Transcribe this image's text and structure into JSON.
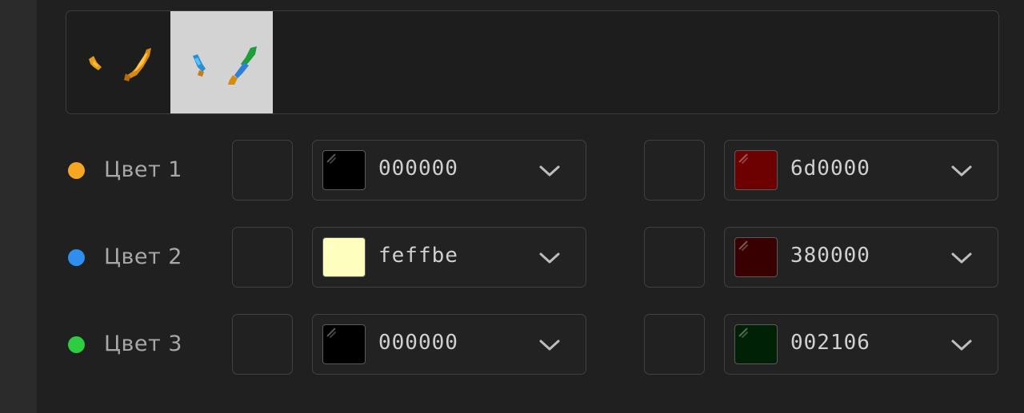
{
  "preview": {
    "thumbnails": [
      {
        "name": "orange-swords-variant",
        "background": "#1d1d1d",
        "selected": false
      },
      {
        "name": "blue-green-swords-variant",
        "background": "#d3d3d3",
        "selected": true
      }
    ]
  },
  "color_rows": [
    {
      "label": "Цвет 1",
      "dot_color": "#f5a623",
      "primary": {
        "hex": "000000",
        "chip": "#000000"
      },
      "secondary": {
        "hex": "6d0000",
        "chip": "#6d0000"
      }
    },
    {
      "label": "Цвет 2",
      "dot_color": "#2f8fef",
      "primary": {
        "hex": "feffbe",
        "chip": "#feffbe"
      },
      "secondary": {
        "hex": "380000",
        "chip": "#380000"
      }
    },
    {
      "label": "Цвет 3",
      "dot_color": "#2ecc40",
      "primary": {
        "hex": "000000",
        "chip": "#000000"
      },
      "secondary": {
        "hex": "002106",
        "chip": "#002106"
      }
    }
  ],
  "icons": {
    "dropdown": "chevron-down-icon"
  }
}
